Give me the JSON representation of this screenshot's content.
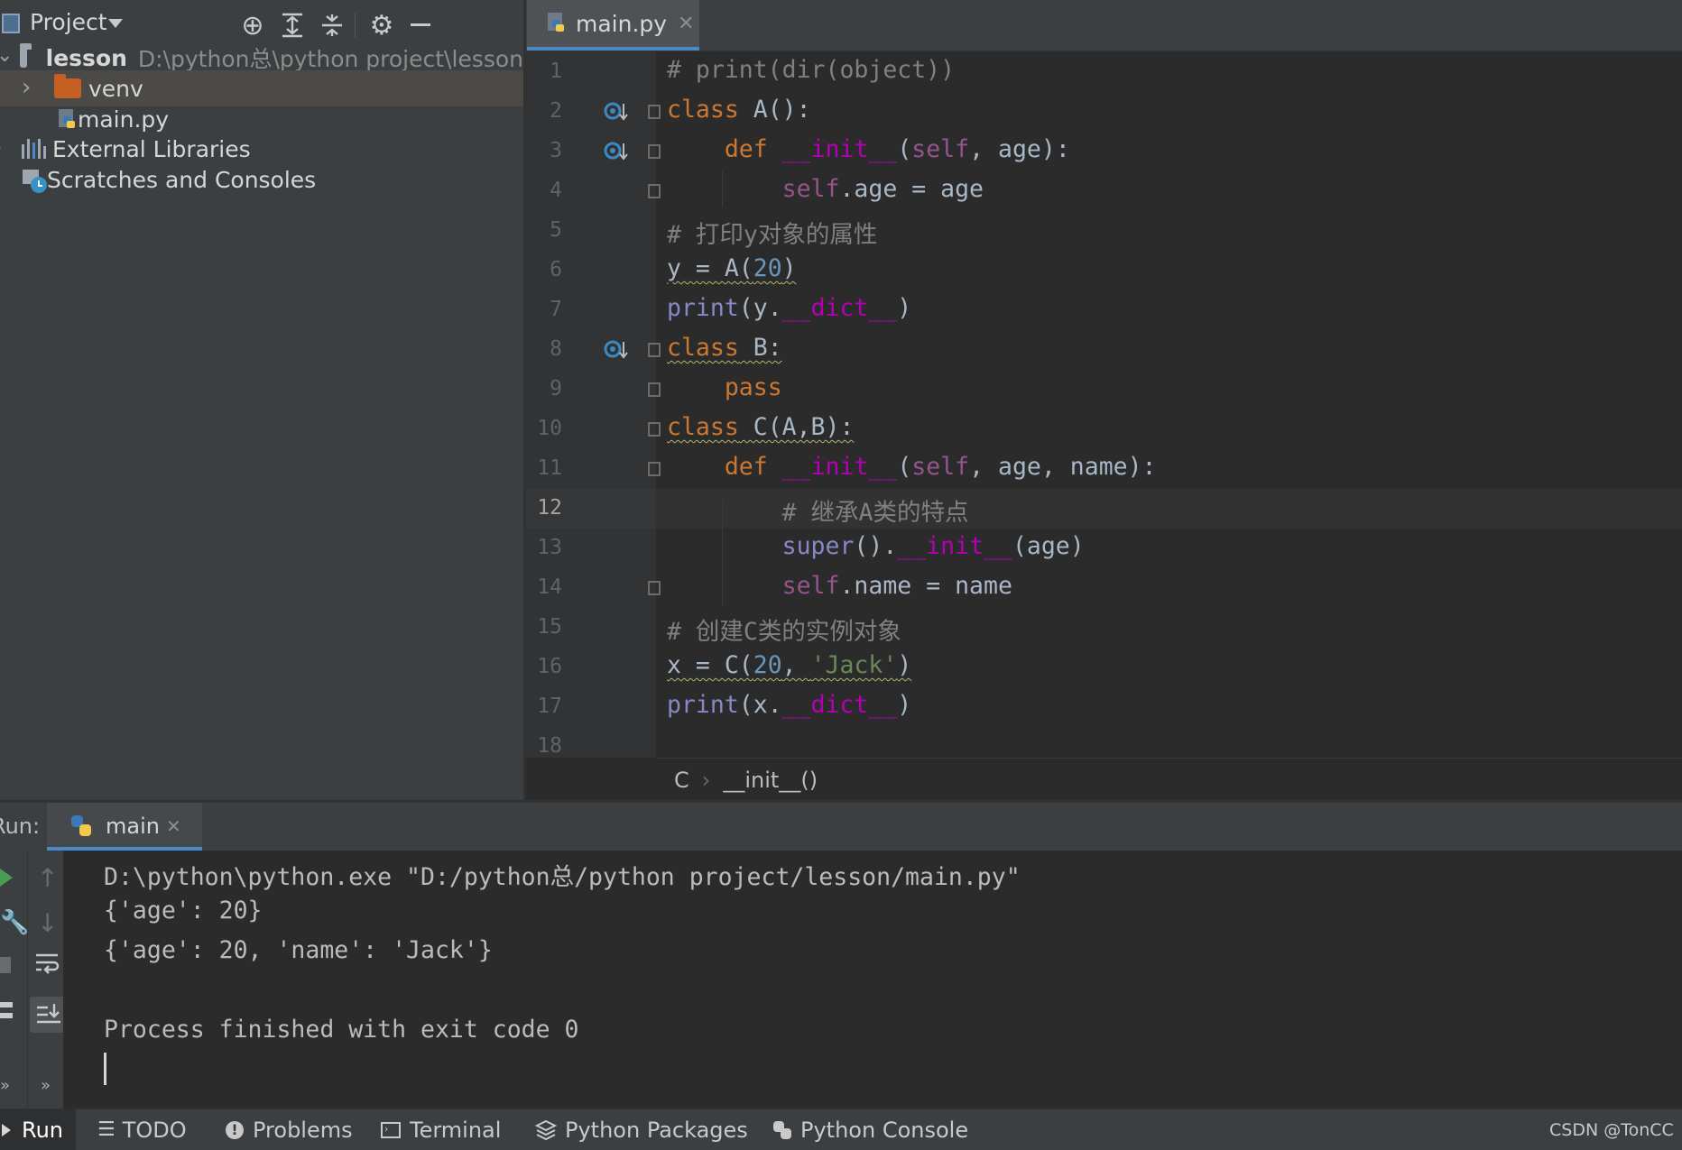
{
  "project_panel": {
    "title": "Project",
    "tree": {
      "root_name": "lesson",
      "root_path": "D:\\python总\\python project\\lesson",
      "venv": "venv",
      "main_file": "main.py",
      "external_libraries": "External Libraries",
      "scratches": "Scratches and Consoles"
    }
  },
  "editor": {
    "tab_label": "main.py",
    "line_numbers": [
      "1",
      "2",
      "3",
      "4",
      "5",
      "6",
      "7",
      "8",
      "9",
      "10",
      "11",
      "12",
      "13",
      "14",
      "15",
      "16",
      "17",
      "18"
    ],
    "active_line": "12",
    "code": {
      "l1": "# print(dir(object))",
      "l2_kw": "class",
      "l2_rest": " A():",
      "l3_kw": "def",
      "l3_name": "__init__",
      "l3_open": "(",
      "l3_self": "self",
      "l3_rest": ", age):",
      "l4_self": "self",
      "l4_rest": ".age = age",
      "l5": "# 打印y对象的属性",
      "l6_a": "y = A(",
      "l6_num": "20",
      "l6_b": ")",
      "l7_print": "print",
      "l7_a": "(y.",
      "l7_dict": "__dict__",
      "l7_b": ")",
      "l8_kw": "class",
      "l8_rest": " B:",
      "l9_kw": "pass",
      "l10_kw": "class",
      "l10_rest": " C(A,B):",
      "l11_kw": "def",
      "l11_name": "__init__",
      "l11_open": "(",
      "l11_self": "self",
      "l11_rest": ", age, name):",
      "l12": "# 继承A类的特点",
      "l13_super": "super",
      "l13_a": "().",
      "l13_init": "__init__",
      "l13_b": "(age)",
      "l14_self": "self",
      "l14_rest": ".name = name",
      "l15": "# 创建C类的实例对象",
      "l16_a": "x = C(",
      "l16_num": "20",
      "l16_comma": ", ",
      "l16_str": "'Jack'",
      "l16_b": ")",
      "l17_print": "print",
      "l17_a": "(x.",
      "l17_dict": "__dict__",
      "l17_b": ")"
    },
    "breadcrumb": {
      "class": "C",
      "method": "__init__()"
    }
  },
  "run_panel": {
    "label": "Run:",
    "tab": "main",
    "output": [
      "D:\\python\\python.exe \"D:/python总/python project/lesson/main.py\"",
      "{'age': 20}",
      "{'age': 20, 'name': 'Jack'}",
      "",
      "Process finished with exit code 0"
    ]
  },
  "bottom_bar": {
    "run": "Run",
    "todo": "TODO",
    "problems": "Problems",
    "terminal": "Terminal",
    "python_packages": "Python Packages",
    "python_console": "Python Console",
    "watermark": "CSDN @TonCC"
  },
  "colors": {
    "background": "#2b2b2b",
    "panel": "#3c3f41",
    "keyword": "#cc7832",
    "comment": "#808080",
    "string": "#6a8759",
    "number": "#6897bb",
    "dunder": "#b200b2",
    "self": "#94558d",
    "accent": "#4a88c7"
  }
}
